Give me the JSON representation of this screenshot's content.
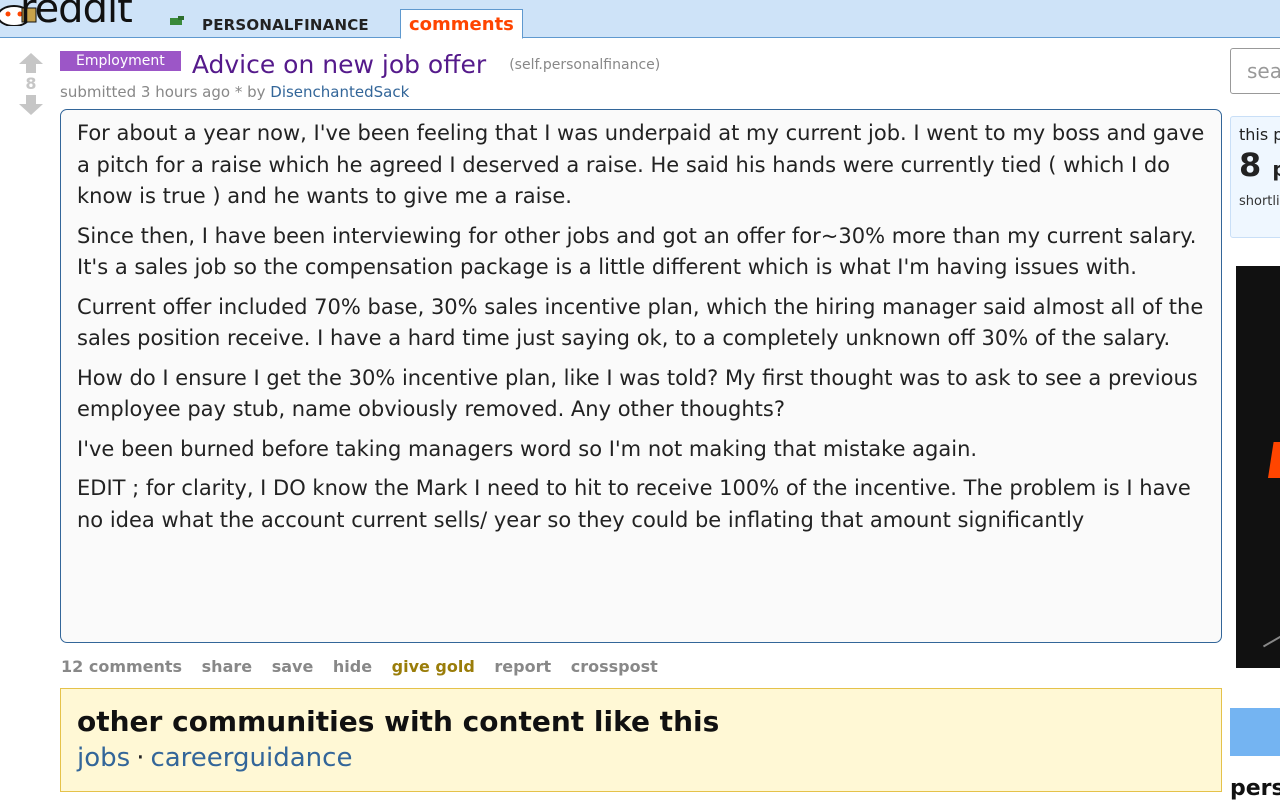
{
  "header": {
    "logo_text": "reddit",
    "subreddit": "PERSONALFINANCE",
    "active_tab": "comments"
  },
  "post": {
    "score": "8",
    "flair": "Employment",
    "title": "Advice on new job offer",
    "domain": "(self.personalfinance)",
    "tagline_prefix": "submitted 3 hours ago * by",
    "author": "DisenchantedSack",
    "body": [
      "For about a year now, I've been feeling that I was underpaid at my current job. I went to my boss and gave a pitch for a raise which he agreed I deserved a raise. He said his hands were currently tied ( which I do know is true ) and he wants to give me a raise.",
      "Since then, I have been interviewing for other jobs and got an offer for~30% more than my current salary. It's a sales job so the compensation package is a little different which is what I'm having issues with.",
      "Current offer included 70% base, 30% sales incentive plan, which the hiring manager said almost all of the sales position receive. I have a hard time just saying ok, to a completely unknown off 30% of the salary.",
      "How do I ensure I get the 30% incentive plan, like I was told? My first thought was to ask to see a previous employee pay stub, name obviously removed. Any other thoughts?",
      "I've been burned before taking managers word so I'm not making that mistake again.",
      "EDIT ; for clarity, I DO know the Mark I need to hit to receive 100% of the incentive. The problem is I have no idea what the account current sells/ year so they could be inflating that amount significantly"
    ],
    "buttons": {
      "comments": "12 comments",
      "share": "share",
      "save": "save",
      "hide": "hide",
      "give_gold": "give gold",
      "report": "report",
      "crosspost": "crosspost"
    }
  },
  "other_communities": {
    "title": "other communities with content like this",
    "links": [
      "jobs",
      "careerguidance"
    ],
    "separator": "·"
  },
  "sidebar": {
    "search_placeholder": "sea",
    "this_post_prefix": "this p",
    "points": "8",
    "points_suffix": "p",
    "shortlink_prefix": "shortli",
    "partial_heading": "pers"
  },
  "colors": {
    "header_bg": "#cee3f8",
    "flair_bg": "#9c56c7",
    "title_link": "#551a8b",
    "active_tab": "#ff4500",
    "author_link": "#369",
    "community_bg": "#fff8d5"
  },
  "icons": [
    "upvote-arrow-icon",
    "downvote-arrow-icon",
    "reddit-alien-icon"
  ]
}
